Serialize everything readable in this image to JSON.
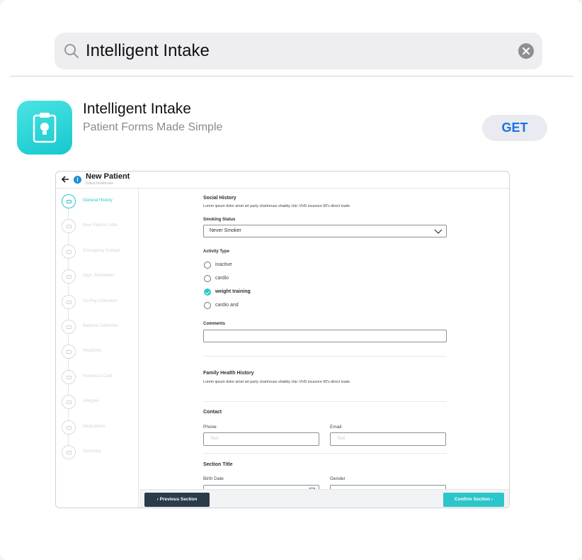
{
  "search": {
    "query": "Intelligent Intake"
  },
  "app": {
    "name": "Intelligent Intake",
    "subtitle": "Patient Forms Made Simple",
    "get_label": "GET",
    "accent": "#1a73e8",
    "icon_color": "#22cfd4"
  },
  "preview": {
    "header": {
      "title": "New Patient",
      "org": "iSalus Healthcare"
    },
    "steps": [
      {
        "label": "General History",
        "active": true
      },
      {
        "label": "New Patient Letter"
      },
      {
        "label": "Emergency Contact"
      },
      {
        "label": "Appt. Reminders"
      },
      {
        "label": "Co-Pay Collection"
      },
      {
        "label": "Balance Collection"
      },
      {
        "label": "Headshot"
      },
      {
        "label": "Insurance Card"
      },
      {
        "label": "Allergies"
      },
      {
        "label": "Medications"
      },
      {
        "label": "Summary"
      }
    ],
    "form": {
      "social_title": "Social History",
      "social_desc": "Lorem ipsum dolor amet art party chartreuse shabby chic VHS locavore 90's direct trade.",
      "smoking_label": "Smoking Status",
      "smoking_value": "Never Smoker",
      "activity_label": "Activity Type",
      "activity_options": [
        "inactive",
        "cardio",
        "weight training",
        "cardio and"
      ],
      "activity_selected": "weight training",
      "comments_label": "Comments",
      "family_title": "Family Health History",
      "family_desc": "Lorem ipsum dolor amet art party chartreuse shabby chic VHS locavore 90's direct trade.",
      "contact_title": "Contact",
      "phone_label": "Phone",
      "phone_placeholder": "Text",
      "email_label": "Email",
      "email_placeholder": "Text",
      "section_title": "Section Title",
      "birth_label": "Birth Date",
      "gender_label": "Gender"
    },
    "footer": {
      "prev_label": "‹ Previous Section",
      "confirm_label": "Confirm Section ›"
    },
    "teal": "#2cc5c9"
  }
}
